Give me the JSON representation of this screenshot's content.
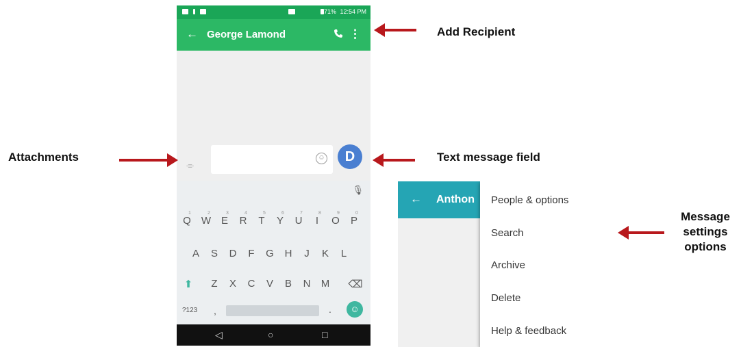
{
  "phone1": {
    "status_bar": {
      "battery_pct": "71%",
      "time": "12:54 PM"
    },
    "app_bar": {
      "back_icon": "←",
      "title": "George Lamond",
      "more_icon": "⋮"
    },
    "compose": {
      "attach_icon": "⌯",
      "emoji_icon": "☺",
      "send_avatar": "D"
    },
    "keyboard": {
      "mic_icon": "🎙",
      "row1": [
        "Q",
        "W",
        "E",
        "R",
        "T",
        "Y",
        "U",
        "I",
        "O",
        "P"
      ],
      "row1_hints": [
        "1",
        "2",
        "3",
        "4",
        "5",
        "6",
        "7",
        "8",
        "9",
        "0"
      ],
      "row2": [
        "A",
        "S",
        "D",
        "F",
        "G",
        "H",
        "J",
        "K",
        "L"
      ],
      "row3": [
        "Z",
        "X",
        "C",
        "V",
        "B",
        "N",
        "M"
      ],
      "shift_icon": "⬆",
      "backspace_icon": "⌫",
      "symbols": "?123",
      "comma": ",",
      "period": ".",
      "emoji_key": "☺"
    },
    "nav_bar": {
      "back": "◁",
      "home": "○",
      "recents": "□"
    }
  },
  "phone2": {
    "app_bar": {
      "back_icon": "←",
      "title": "Anthon"
    },
    "menu": {
      "items": [
        "People & options",
        "Search",
        "Archive",
        "Delete",
        "Help & feedback"
      ]
    }
  },
  "labels": {
    "add_recipient": "Add Recipient",
    "attachments": "Attachments",
    "text_message_field": "Text message field",
    "message_settings": [
      "Message",
      "settings",
      "options"
    ]
  },
  "colors": {
    "green_bar": "#2cb865",
    "teal_bar": "#25a5b4",
    "arrow": "#b8181c",
    "avatar": "#4a7fd1"
  }
}
